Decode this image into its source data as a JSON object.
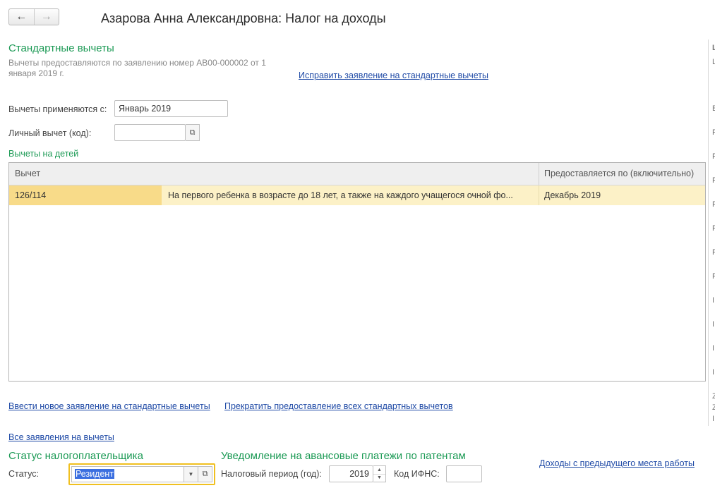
{
  "window": {
    "title": "Азарова Анна Александровна: Налог на доходы"
  },
  "nav": {
    "back_icon": "←",
    "forward_icon": "→"
  },
  "standard": {
    "heading": "Стандартные вычеты",
    "note_line1": "Вычеты предоставляются по заявлению номер АВ00-000002 от 1",
    "note_line2": "января 2019 г.",
    "edit_link": "Исправить заявление на стандартные вычеты",
    "apply_from_label": "Вычеты применяются с:",
    "apply_from_value": "Январь 2019",
    "personal_label": "Личный вычет (код):",
    "personal_value": ""
  },
  "children": {
    "heading": "Вычеты на детей",
    "columns": [
      "Вычет",
      "Предоставляется по (включительно)"
    ],
    "rows": [
      {
        "code": "126/114",
        "description": "На первого ребенка в возрасте до 18 лет, а также на каждого учащегося очной фо...",
        "until": "Декабрь 2019"
      }
    ]
  },
  "links": {
    "new_application": "Ввести новое заявление на стандартные вычеты",
    "stop_all": "Прекратить предоставление всех стандартных вычетов",
    "all_applications": "Все заявления на вычеты",
    "prev_income": "Доходы с предыдущего места работы"
  },
  "status_section": {
    "heading": "Статус налогоплательщика",
    "status_label": "Статус:",
    "status_value": "Резидент"
  },
  "patent": {
    "heading": "Уведомление на авансовые платежи по патентам",
    "period_label": "Налоговый период (год):",
    "period_value": "2019",
    "ifns_label": "Код ИФНС:",
    "ifns_value": ""
  },
  "right_panel_letters": [
    "L",
    "L",
    "E",
    "F",
    "F",
    "F",
    "F",
    "F",
    "F",
    "F",
    "I",
    "I",
    "I",
    "I",
    "Z",
    "Z",
    "I"
  ],
  "colors": {
    "accent_green": "#1c9a55",
    "link_blue": "#1f4aa6",
    "row_selected": "#fcf1c7",
    "cell_selected": "#f8db89",
    "focus": "#f0c020"
  }
}
